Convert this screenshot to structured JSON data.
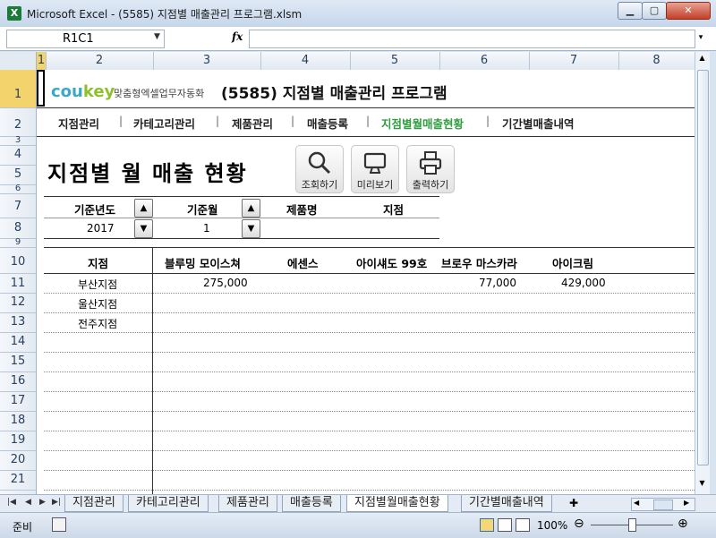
{
  "window": {
    "title": "Microsoft Excel - (5585) 지점별 매출관리 프로그램.xlsm",
    "app_icon": "X"
  },
  "formula_bar": {
    "name_box": "R1C1",
    "fx": "fx",
    "value": ""
  },
  "columns": [
    "1",
    "2",
    "3",
    "4",
    "5",
    "6",
    "7",
    "8"
  ],
  "rows": [
    "1",
    "2",
    "3",
    "4",
    "5",
    "6",
    "7",
    "8",
    "9",
    "10",
    "11",
    "12",
    "13",
    "14",
    "15",
    "16",
    "17",
    "18",
    "19",
    "20",
    "21"
  ],
  "sheet": {
    "logo": {
      "brand_a": "cou",
      "brand_b": "key",
      "tagline": "맞춤형엑셀업무자동화"
    },
    "program_title": "(5585) 지점별 매출관리 프로그램",
    "nav": [
      "지점관리",
      "카테고리관리",
      "제품관리",
      "매출등록",
      "지점별월매출현황",
      "기간별매출내역"
    ],
    "nav_active_color": "#2e9e3e",
    "page_title": "지점별 월 매출 현황",
    "buttons": {
      "search": "조회하기",
      "preview": "미리보기",
      "print": "출력하기"
    },
    "filter": {
      "headers": {
        "year": "기준년도",
        "month": "기준월",
        "product": "제품명",
        "branch": "지점"
      },
      "values": {
        "year": "2017",
        "month": "1",
        "product": "",
        "branch": ""
      }
    },
    "table": {
      "headers": [
        "지점",
        "블루밍 모이스쳐",
        "에센스",
        "아이섀도 99호",
        "브로우 마스카라",
        "아이크림"
      ],
      "rows": [
        {
          "branch": "부산지점",
          "c1": "275,000",
          "c2": "",
          "c3": "",
          "c4": "77,000",
          "c5": "429,000"
        },
        {
          "branch": "울산지점",
          "c1": "",
          "c2": "",
          "c3": "",
          "c4": "",
          "c5": ""
        },
        {
          "branch": "전주지점",
          "c1": "",
          "c2": "",
          "c3": "",
          "c4": "",
          "c5": ""
        }
      ]
    }
  },
  "tabs": [
    "지점관리",
    "카테고리관리",
    "제품관리",
    "매출등록",
    "지점별월매출현황",
    "기간별매출내역"
  ],
  "active_tab": "지점별월매출현황",
  "status": {
    "ready": "준비",
    "zoom": "100%"
  }
}
